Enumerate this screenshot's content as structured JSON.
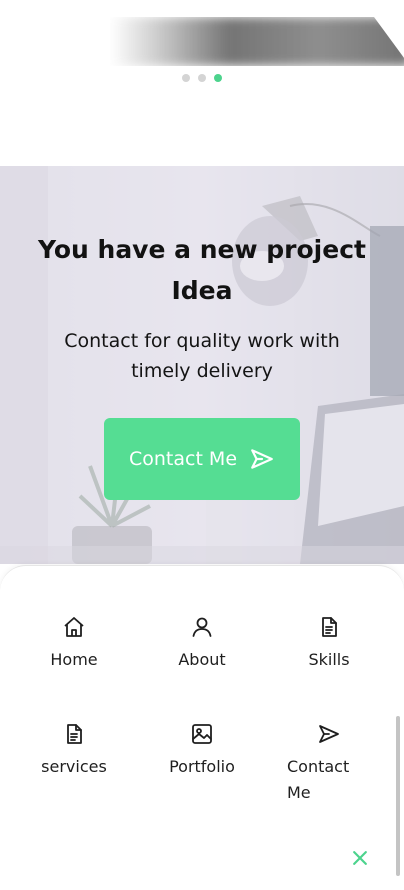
{
  "carousel": {
    "dots": [
      {
        "active": false
      },
      {
        "active": false
      },
      {
        "active": true
      }
    ],
    "accent_color": "#4cd38d"
  },
  "hero": {
    "title": "You have a new project Idea",
    "subtitle": "Contact for quality work with timely delivery",
    "button_label": "Contact Me",
    "button_icon": "send-icon",
    "button_color": "#55dd93"
  },
  "nav": {
    "items": [
      {
        "label": "Home",
        "icon": "home-icon"
      },
      {
        "label": "About",
        "icon": "user-icon"
      },
      {
        "label": "Skills",
        "icon": "document-icon"
      },
      {
        "label": "services",
        "icon": "document-icon"
      },
      {
        "label": "Portfolio",
        "icon": "image-icon"
      },
      {
        "label": "Contact Me",
        "icon": "send-icon"
      }
    ],
    "close_icon": "close-icon"
  }
}
